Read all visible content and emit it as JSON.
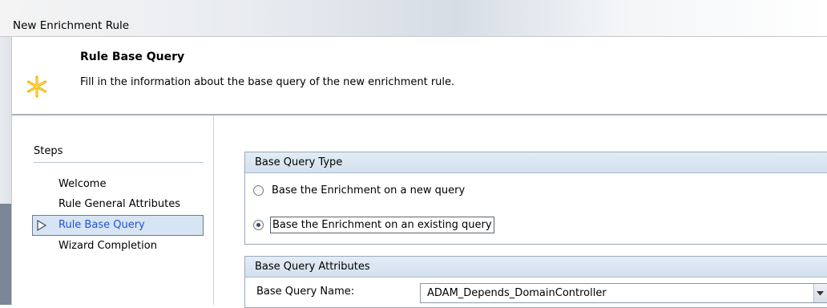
{
  "window": {
    "title": "New Enrichment Rule"
  },
  "header": {
    "heading": "Rule Base Query",
    "description": "Fill in the information about the base query of the new enrichment rule.",
    "icon": "asterisk-star-icon"
  },
  "steps": {
    "title": "Steps",
    "items": [
      {
        "label": "Welcome",
        "current": false
      },
      {
        "label": "Rule General Attributes",
        "current": false
      },
      {
        "label": "Rule Base Query",
        "current": true
      },
      {
        "label": "Wizard Completion",
        "current": false
      }
    ]
  },
  "base_query_type": {
    "title": "Base Query Type",
    "options": [
      {
        "label": "Base the Enrichment on a new query",
        "selected": false
      },
      {
        "label": "Base the Enrichment on an existing query",
        "selected": true
      }
    ]
  },
  "base_query_attributes": {
    "title": "Base Query Attributes",
    "name_label": "Base Query Name:",
    "name_value": "ADAM_Depends_DomainController"
  },
  "colors": {
    "accent": "#d6e4f3",
    "current_step_text": "#2255cc",
    "star": "#f2b600"
  }
}
